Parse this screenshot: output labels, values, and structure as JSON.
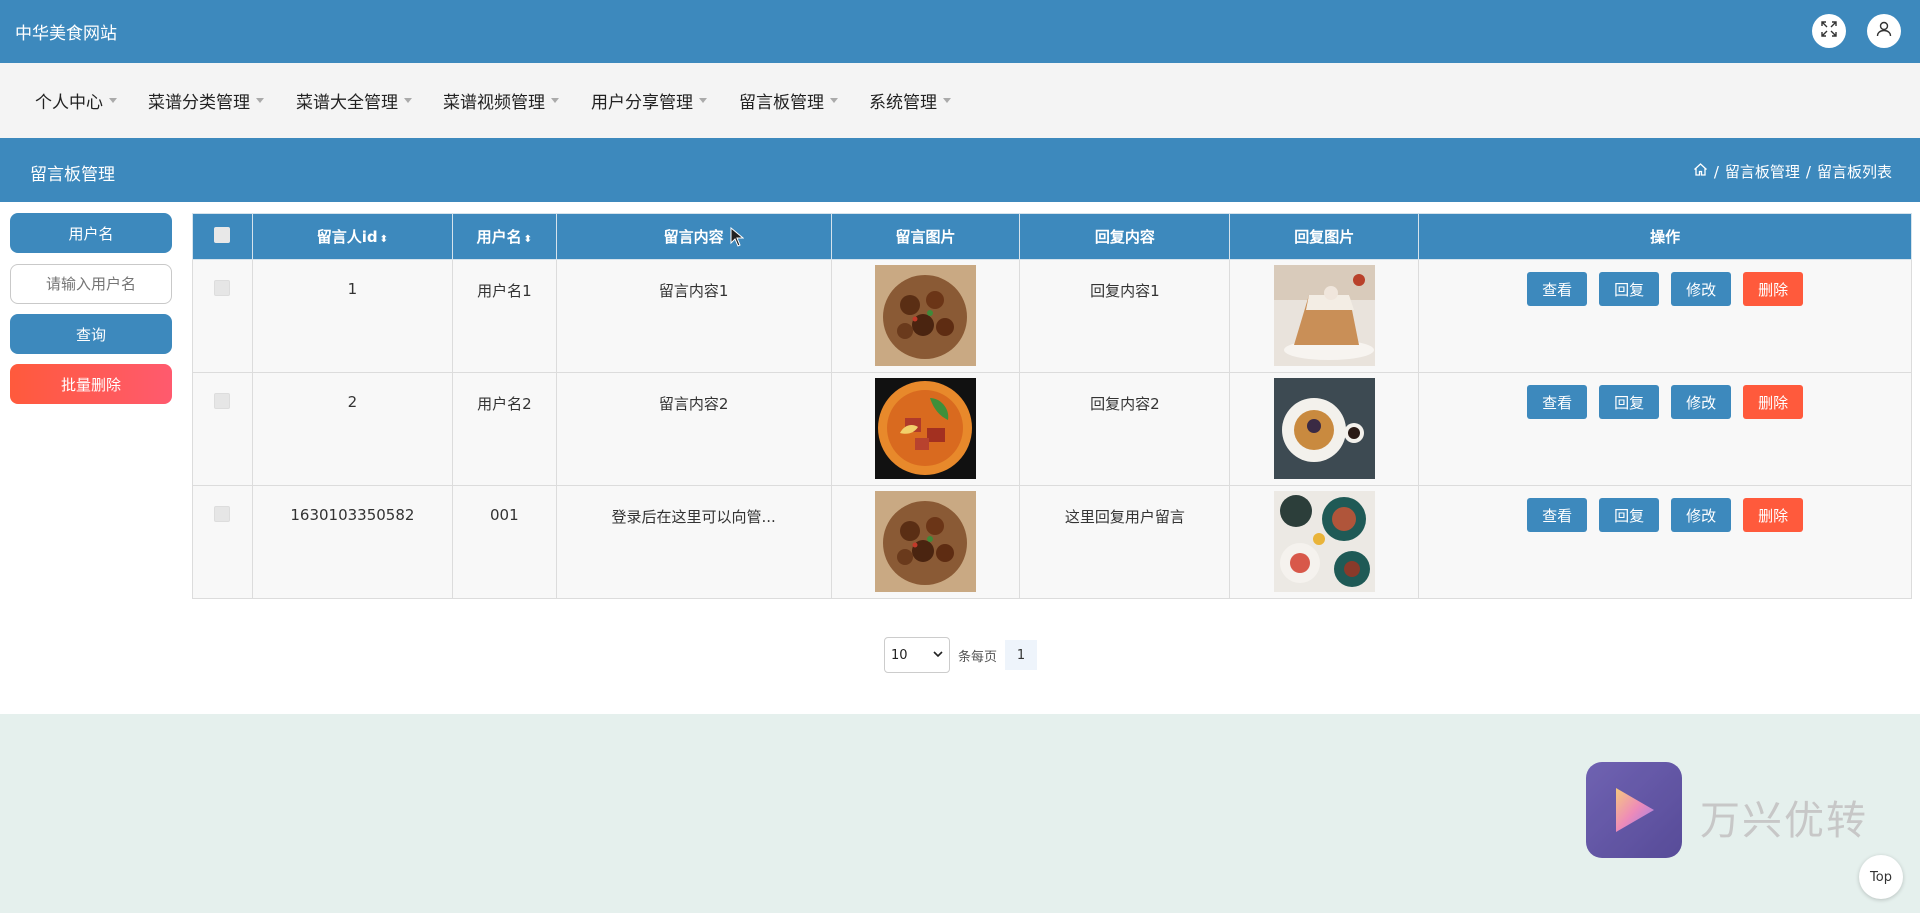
{
  "header": {
    "site_title": "中华美食网站"
  },
  "nav": {
    "items": [
      {
        "label": "个人中心"
      },
      {
        "label": "菜谱分类管理"
      },
      {
        "label": "菜谱大全管理"
      },
      {
        "label": "菜谱视频管理"
      },
      {
        "label": "用户分享管理"
      },
      {
        "label": "留言板管理"
      },
      {
        "label": "系统管理"
      }
    ]
  },
  "subheader": {
    "title": "留言板管理",
    "breadcrumb": [
      "留言板管理",
      "留言板列表"
    ]
  },
  "sidebar": {
    "label": "用户名",
    "input_placeholder": "请输入用户名",
    "query_button": "查询",
    "batch_delete_button": "批量删除"
  },
  "table": {
    "columns": [
      "留言人id",
      "用户名",
      "留言内容",
      "留言图片",
      "回复内容",
      "回复图片",
      "操作"
    ],
    "rows": [
      {
        "id": "1",
        "username": "用户名1",
        "content": "留言内容1",
        "reply": "回复内容1"
      },
      {
        "id": "2",
        "username": "用户名2",
        "content": "留言内容2",
        "reply": "回复内容2"
      },
      {
        "id": "1630103350582",
        "username": "001",
        "content": "登录后在这里可以向管...",
        "reply": "这里回复用户留言"
      }
    ],
    "actions": {
      "view": "查看",
      "reply": "回复",
      "edit": "修改",
      "delete": "删除"
    }
  },
  "pager": {
    "page_size": "10",
    "per_page_label": "条每页",
    "current_page": "1"
  },
  "watermark": {
    "text": "万兴优转"
  },
  "back_to_top": "Top",
  "colors": {
    "primary": "#3d89bd",
    "danger": "#ff5a3c",
    "background": "#e5f0ed"
  }
}
